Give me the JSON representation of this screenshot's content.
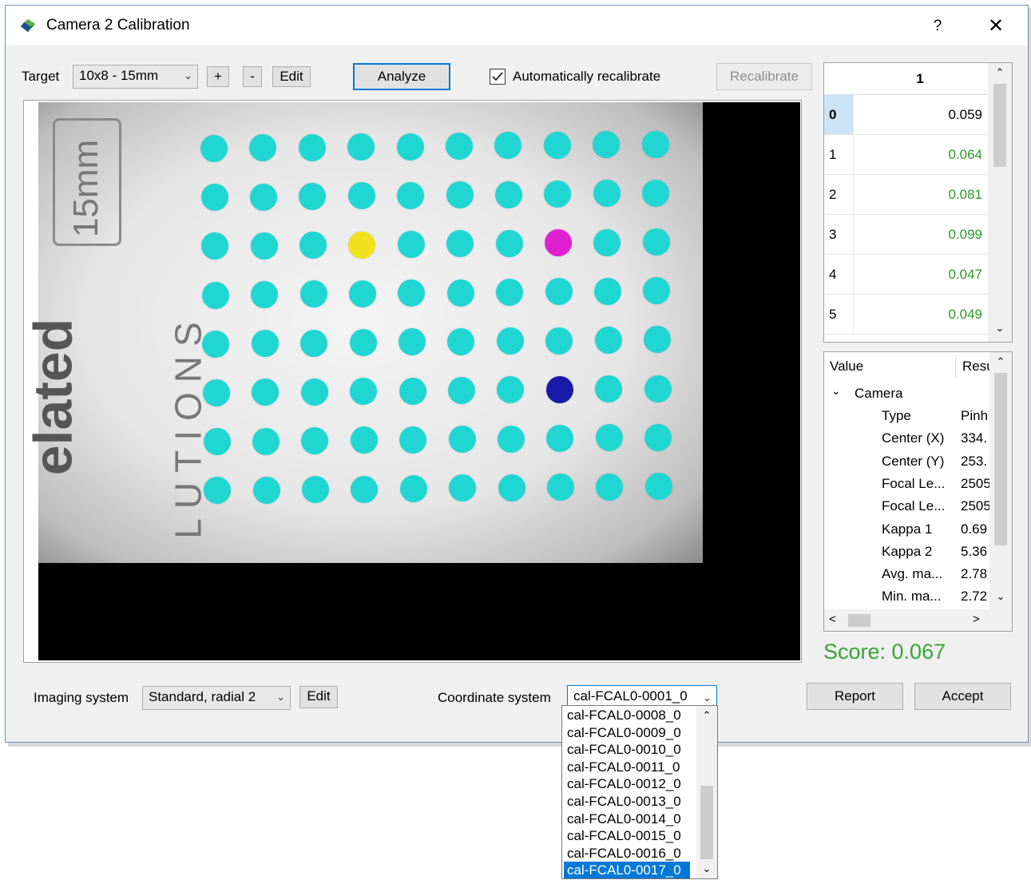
{
  "window": {
    "title": "Camera 2 Calibration",
    "help_label": "?",
    "close_label": "✕"
  },
  "toolbar": {
    "target_label": "Target",
    "target_value": "10x8 - 15mm",
    "plus_label": "+",
    "minus_label": "-",
    "edit_label": "Edit",
    "analyze_label": "Analyze",
    "auto_recalibrate_label": "Automatically recalibrate",
    "auto_recalibrate_checked": true,
    "recalibrate_label": "Recalibrate"
  },
  "image": {
    "label_15mm": "15mm",
    "logo_bold": "elated",
    "logo_light": "LUTIONS",
    "grid": {
      "columns": 10,
      "rows": 8
    },
    "highlight_dots": [
      {
        "row": 2,
        "col": 3,
        "color": "#f0e020"
      },
      {
        "row": 2,
        "col": 7,
        "color": "#e020d0"
      },
      {
        "row": 5,
        "col": 7,
        "color": "#1a1aa8"
      }
    ],
    "dot_color": "#20d6d2"
  },
  "error_grid": {
    "column_header": "1",
    "rows": [
      {
        "index": "0",
        "value": "0.059",
        "selected": true
      },
      {
        "index": "1",
        "value": "0.064"
      },
      {
        "index": "2",
        "value": "0.081"
      },
      {
        "index": "3",
        "value": "0.099"
      },
      {
        "index": "4",
        "value": "0.047"
      },
      {
        "index": "5",
        "value": "0.049"
      }
    ],
    "value_color": "#2b9a2b"
  },
  "tree": {
    "col_value": "Value",
    "col_result": "Resu",
    "group": "Camera",
    "items": [
      {
        "name": "Type",
        "value": "Pinh"
      },
      {
        "name": "Center (X)",
        "value": "334."
      },
      {
        "name": "Center (Y)",
        "value": "253."
      },
      {
        "name": "Focal Le...",
        "value": "2505"
      },
      {
        "name": "Focal Le...",
        "value": "2505"
      },
      {
        "name": "Kappa 1",
        "value": "0.69"
      },
      {
        "name": "Kappa 2",
        "value": "5.36"
      },
      {
        "name": "Avg. ma...",
        "value": "2.78"
      },
      {
        "name": "Min. ma...",
        "value": "2.72"
      }
    ]
  },
  "score": "Score: 0.067",
  "bottom": {
    "imaging_label": "Imaging system",
    "imaging_value": "Standard, radial 2",
    "imaging_edit": "Edit",
    "coord_label": "Coordinate system",
    "coord_value": "cal-FCAL0-0001_0",
    "report_label": "Report",
    "accept_label": "Accept"
  },
  "dropdown": {
    "items": [
      "cal-FCAL0-0008_0",
      "cal-FCAL0-0009_0",
      "cal-FCAL0-0010_0",
      "cal-FCAL0-0011_0",
      "cal-FCAL0-0012_0",
      "cal-FCAL0-0013_0",
      "cal-FCAL0-0014_0",
      "cal-FCAL0-0015_0",
      "cal-FCAL0-0016_0",
      "cal-FCAL0-0017_0"
    ],
    "selected_index": 9,
    "accent": "#0078d7"
  }
}
